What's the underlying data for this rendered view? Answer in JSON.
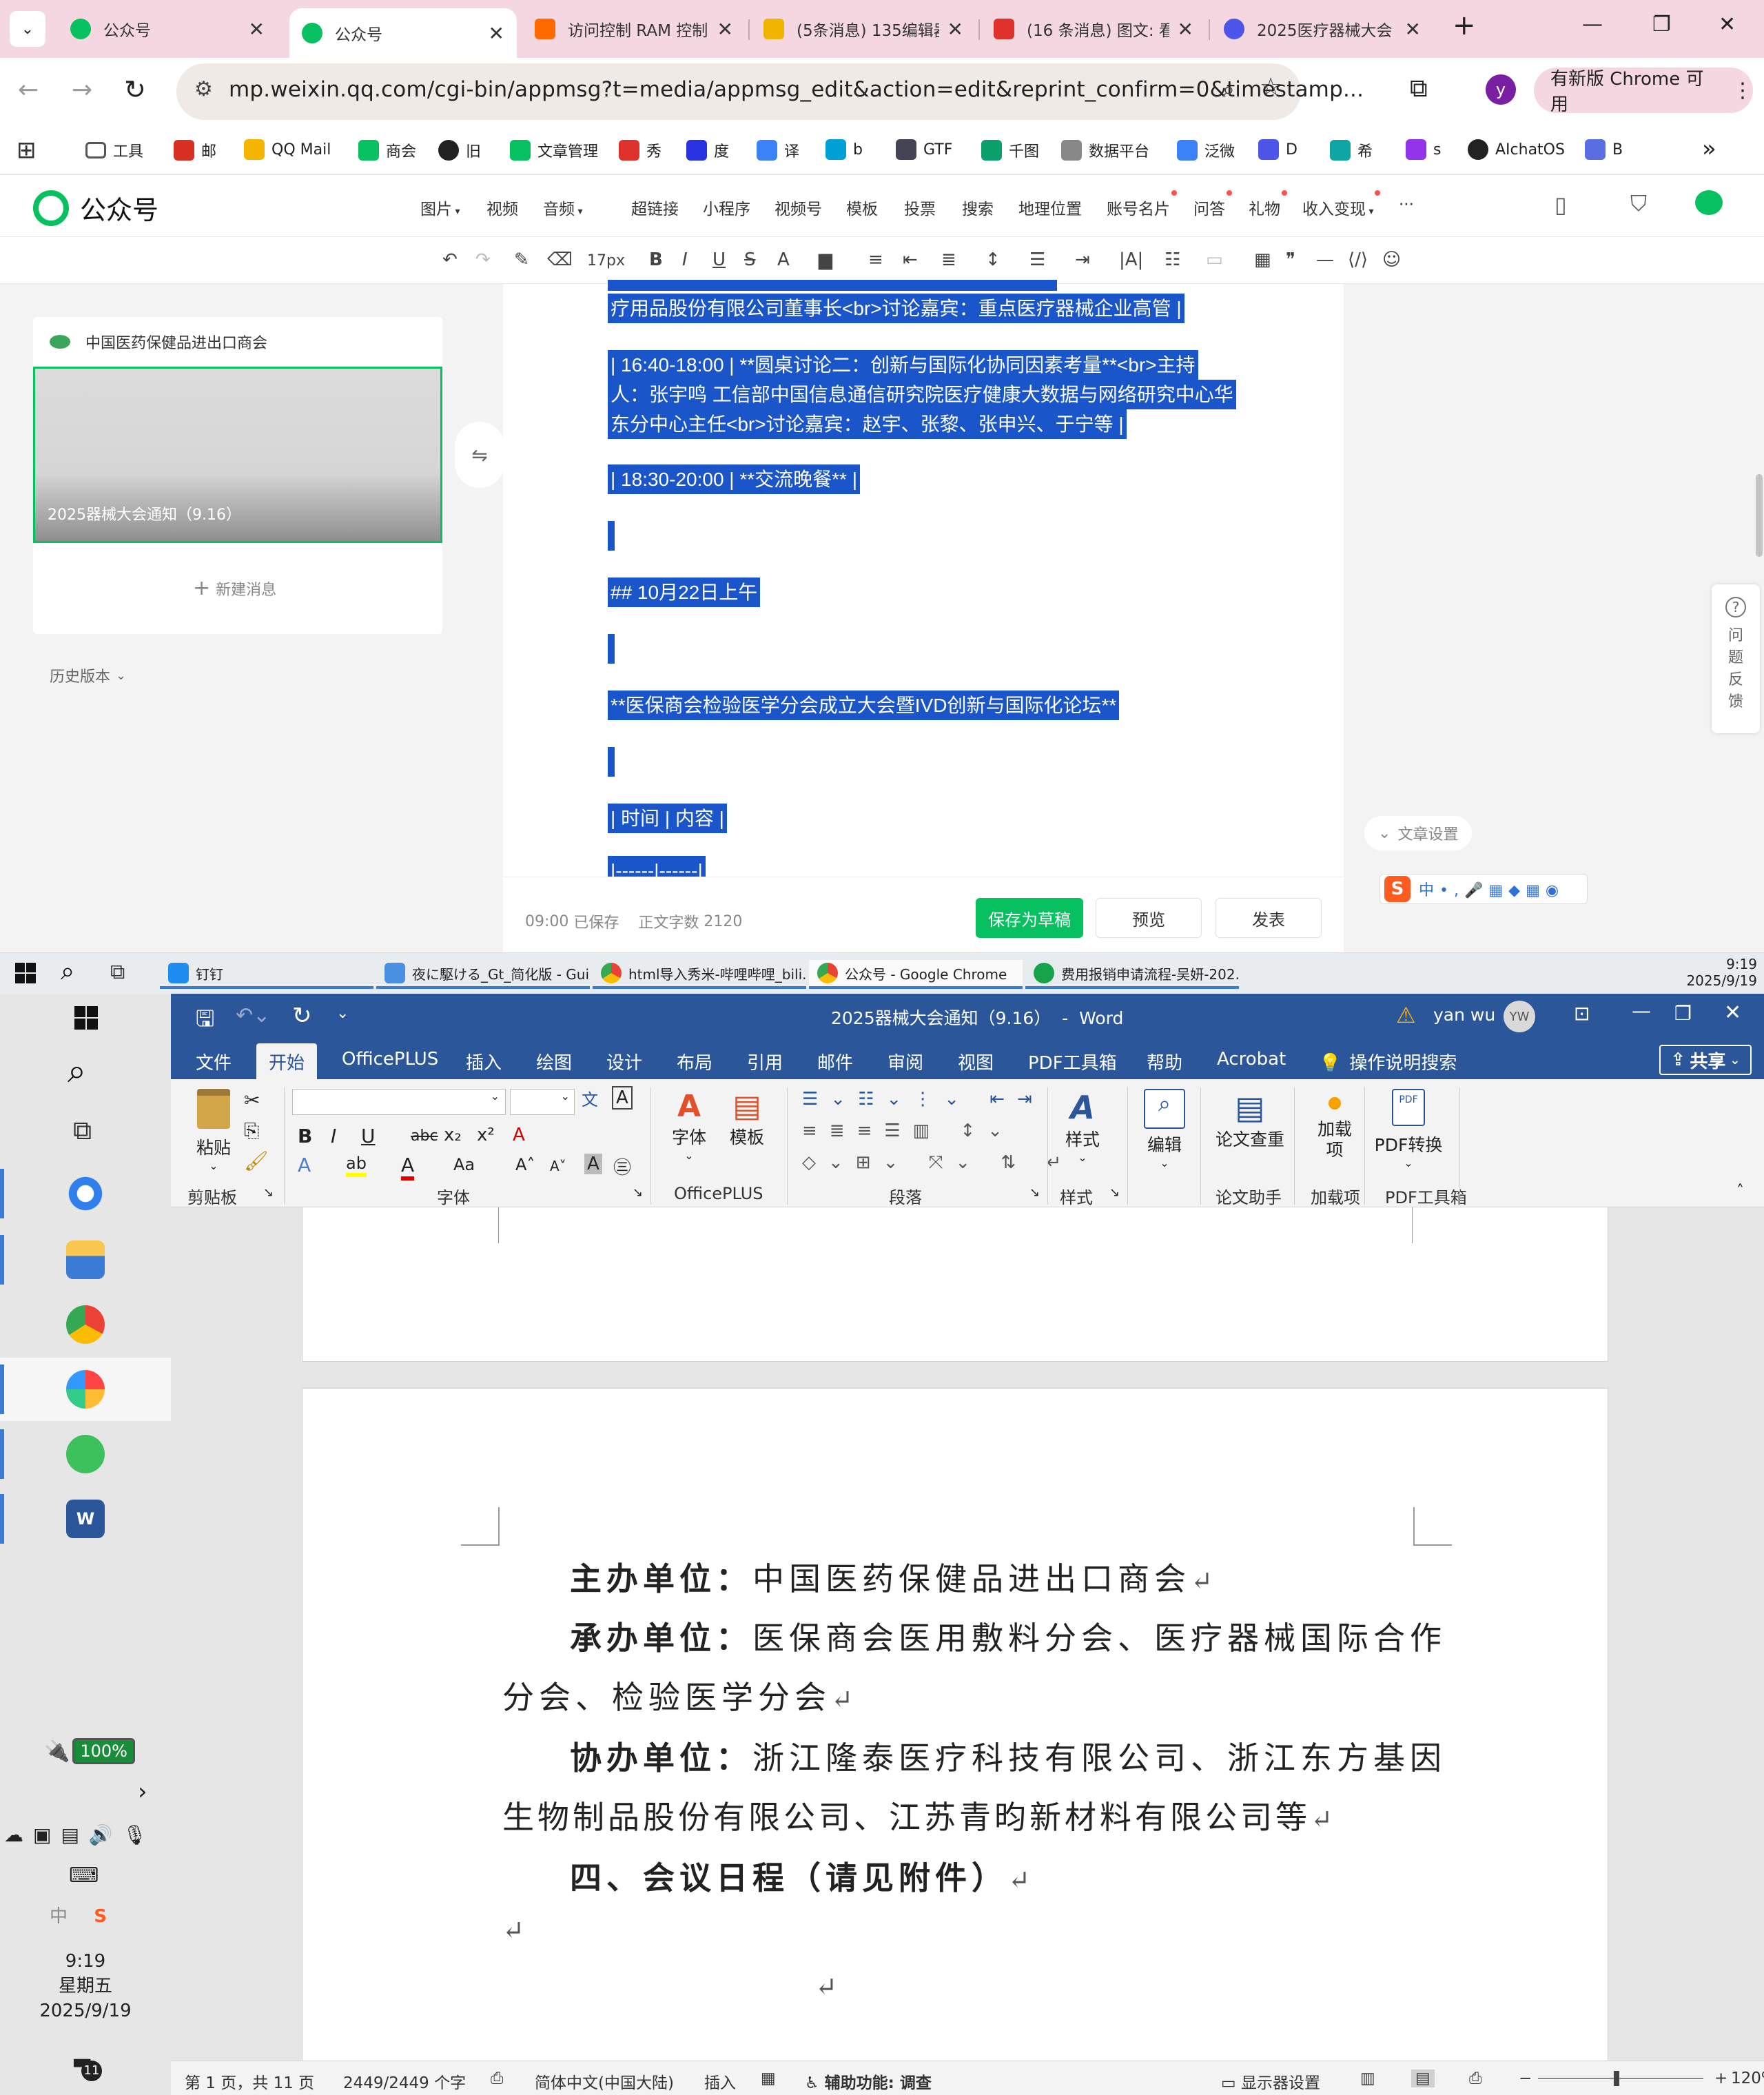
{
  "chrome": {
    "tabs": [
      {
        "title": "公众号",
        "favicon_color": "#07c160"
      },
      {
        "title": "公众号",
        "favicon_color": "#07c160",
        "active": true
      },
      {
        "title": "访问控制 RAM 控制",
        "favicon_color": "#ff6a00"
      },
      {
        "title": "(5条消息) 135编辑器",
        "favicon_color": "#f0b400"
      },
      {
        "title": "(16 条消息) 图文: 看",
        "favicon_color": "#e0322d"
      },
      {
        "title": "2025医疗器械大会",
        "favicon_color": "#4d55e8"
      }
    ],
    "new_tab": "+",
    "url": "mp.weixin.qq.com/cgi-bin/appmsg?t=media/appmsg_edit&action=edit&reprint_confirm=0&timestamp...",
    "profile_initial": "y",
    "update_label": "有新版 Chrome 可用",
    "bookmarks": [
      {
        "label": "工具",
        "icon": "folder-icon"
      },
      {
        "label": "邮",
        "icon": "mail-icon"
      },
      {
        "label": "QQ Mail",
        "icon": "qqmail-icon"
      },
      {
        "label": "商会",
        "icon": "wechat-icon"
      },
      {
        "label": "旧",
        "icon": "globe-icon"
      },
      {
        "label": "文章管理",
        "icon": "wechat-icon"
      },
      {
        "label": "秀",
        "icon": "xiu-icon"
      },
      {
        "label": "度",
        "icon": "baidu-icon"
      },
      {
        "label": "译",
        "icon": "translate-icon"
      },
      {
        "label": "b",
        "icon": "bilibili-icon"
      },
      {
        "label": "GTF",
        "icon": "gtf-icon"
      },
      {
        "label": "千图",
        "icon": "qiantu-icon"
      },
      {
        "label": "数据平台",
        "icon": "doc-icon"
      },
      {
        "label": "泛微",
        "icon": "fanwei-icon"
      },
      {
        "label": "D",
        "icon": "d-icon"
      },
      {
        "label": "希",
        "icon": "xi-icon"
      },
      {
        "label": "s",
        "icon": "s-icon"
      },
      {
        "label": "AIchatOS",
        "icon": "openai-icon"
      },
      {
        "label": "B",
        "icon": "b-icon"
      }
    ],
    "more": "»"
  },
  "mp": {
    "logo": "公众号",
    "nav": [
      "图片",
      "视频",
      "音频",
      "超链接",
      "小程序",
      "视频号",
      "模板",
      "投票",
      "搜索",
      "地理位置",
      "账号名片",
      "问答",
      "礼物",
      "收入变现",
      "···"
    ],
    "font_size": "17px",
    "account_name": "中国医药保健品进出口商会",
    "cover_title": "2025器械大会通知（9.16）",
    "new_message": "新建消息",
    "history": "历史版本",
    "swap_icon": "⇋",
    "editor_lines": [
      "疗用品股份有限公司董事长<br>讨论嘉宾：重点医疗器械企业高管 |",
      "| 16:40-18:00 | **圆桌讨论二：创新与国际化协同因素考量**<br>主持",
      "人：张宇鸣 工信部中国信息通信研究院医疗健康大数据与网络研究中心华",
      "东分中心主任<br>讨论嘉宾：赵宇、张黎、张申兴、于宁等 |",
      "| 18:30-20:00 | **交流晚餐** |",
      "## 10月22日上午",
      "**医保商会检验医学分会成立大会暨IVD创新与国际化论坛**",
      "| 时间 | 内容 |",
      "|------|------|"
    ],
    "footer": {
      "time": "09:00",
      "saved": "已保存",
      "word_count_label": "正文字数",
      "word_count": "2120",
      "save_draft": "保存为草稿",
      "preview": "预览",
      "publish": "发表"
    },
    "feedback": [
      "问",
      "题",
      "反",
      "馈"
    ],
    "article_settings": "文章设置"
  },
  "taskbar": {
    "items": [
      "钉钉",
      "夜に駆ける_Gt_简化版 - Gui...",
      "html导入秀米-哔哩哔哩_bili...",
      "公众号 - Google Chrome",
      "费用报销申请流程-吴妍-202..."
    ],
    "time": "9:19",
    "date": "2025/9/19"
  },
  "leftbar": {
    "battery": "100%",
    "clock_time": "9:19",
    "clock_day": "星期五",
    "clock_date": "2025/9/19",
    "notif_count": "11",
    "ime": "中"
  },
  "word": {
    "title": "2025器械大会通知（9.16）  -  Word",
    "user": "yan wu",
    "user_initials": "YW",
    "menu": [
      "文件",
      "开始",
      "OfficePLUS",
      "插入",
      "绘图",
      "设计",
      "布局",
      "引用",
      "邮件",
      "审阅",
      "视图",
      "PDF工具箱",
      "帮助",
      "Acrobat",
      "操作说明搜索"
    ],
    "share": "共享",
    "ribbon": {
      "paste": "粘贴",
      "clipboard": "剪贴板",
      "font_group": "字体",
      "font_btn": "字体",
      "template_btn": "模板",
      "officeplus_group": "OfficePLUS",
      "paragraph_group": "段落",
      "style_btn": "样式",
      "style_group": "样式",
      "edit_btn": "编辑",
      "paper_check": "论文查重",
      "paper_group": "论文助手",
      "addin_btn": "加载项",
      "addin_group": "加载项",
      "pdf_convert": "PDF转换",
      "pdf_group": "PDF工具箱"
    },
    "doc": {
      "host_label": "主办单位：",
      "host": "中国医药保健品进出口商会",
      "organizer_label": "承办单位：",
      "organizer_1": "医保商会医用敷料分会、医疗器械国际合作",
      "organizer_2": "分会、检验医学分会",
      "co_label": "协办单位：",
      "co_1": "浙江隆泰医疗科技有限公司、浙江东方基因",
      "co_2": "生物制品股份有限公司、江苏青昀新材料有限公司等",
      "section4": "四、会议日程（请见附件）"
    },
    "status": {
      "page": "第 1 页，共 11 页",
      "words": "2449/2449 个字",
      "lang": "简体中文(中国大陆)",
      "mode": "插入",
      "accessibility": "辅助功能: 调查",
      "display": "显示器设置",
      "zoom": "120%"
    }
  }
}
